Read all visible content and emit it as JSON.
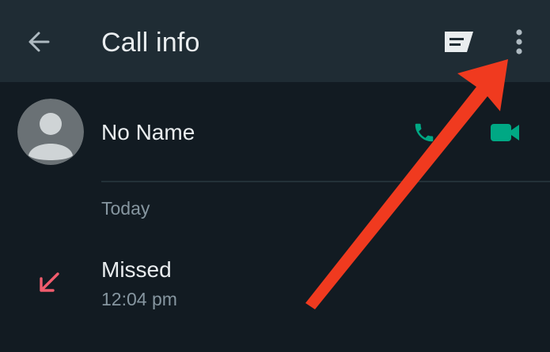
{
  "header": {
    "title": "Call info",
    "back_icon": "arrow-left-icon",
    "message_icon": "message-icon",
    "more_icon": "more-vertical-icon"
  },
  "contact": {
    "name": "No Name",
    "avatar_icon": "default-avatar-icon",
    "voice_call_icon": "phone-icon",
    "video_call_icon": "video-camera-icon"
  },
  "history": {
    "section_label": "Today",
    "calls": [
      {
        "status": "Missed",
        "time": "12:04 pm",
        "direction_icon": "missed-call-arrow-icon"
      }
    ]
  },
  "annotation": {
    "arrow_icon": "red-pointer-arrow"
  },
  "colors": {
    "app_bar": "#1f2c34",
    "background": "#121b22",
    "primary_text": "#e9edef",
    "secondary_text": "#8696a0",
    "accent_green": "#00a884",
    "missed_red": "#f15c6d",
    "annotation_red": "#f03a1f"
  }
}
